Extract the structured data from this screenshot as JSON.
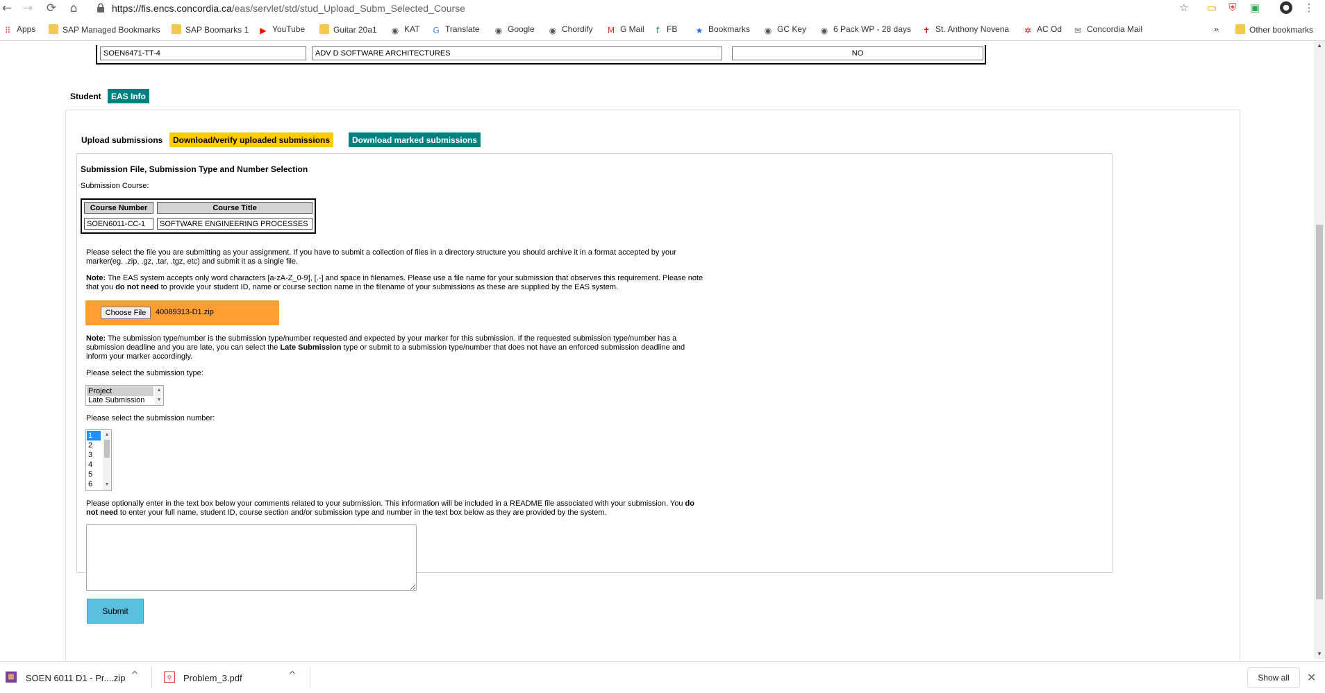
{
  "browser": {
    "url_host": "https://fis.encs.concordia.ca",
    "url_path": "/eas/servlet/std/stud_Upload_Subm_Selected_Course",
    "nav": {
      "back": "←",
      "forward": "→",
      "reload": "⟳",
      "home": "⌂"
    },
    "icons": {
      "star": "☆",
      "menu": "⋮"
    }
  },
  "bookmarks": [
    {
      "label": "Apps",
      "icon": "apps-grid-icon",
      "glyph": "⠿",
      "color": "#e8453c"
    },
    {
      "label": "SAP Managed Bookmarks",
      "icon": "folder-icon",
      "glyph": ""
    },
    {
      "label": "SAP Boomarks 1",
      "icon": "folder-icon",
      "glyph": ""
    },
    {
      "label": "YouTube",
      "icon": "youtube-icon",
      "glyph": "▶",
      "color": "#ff0000"
    },
    {
      "label": "Guitar 20a1",
      "icon": "folder-icon",
      "glyph": ""
    },
    {
      "label": "KAT",
      "icon": "globe-icon",
      "glyph": "◉",
      "color": "#555"
    },
    {
      "label": "Translate",
      "icon": "translate-icon",
      "glyph": "G",
      "color": "#4285f4"
    },
    {
      "label": "Google",
      "icon": "globe-icon",
      "glyph": "◉",
      "color": "#555"
    },
    {
      "label": "Chordify",
      "icon": "globe-icon",
      "glyph": "◉",
      "color": "#555"
    },
    {
      "label": "G Mail",
      "icon": "gmail-icon",
      "glyph": "M",
      "color": "#d93025"
    },
    {
      "label": "FB",
      "icon": "facebook-icon",
      "glyph": "f",
      "color": "#1877f2"
    },
    {
      "label": "Bookmarks",
      "icon": "star-icon",
      "glyph": "★",
      "color": "#1a73e8"
    },
    {
      "label": "GC Key",
      "icon": "globe-icon",
      "glyph": "◉",
      "color": "#555"
    },
    {
      "label": "6 Pack WP - 28 days",
      "icon": "globe-icon",
      "glyph": "◉",
      "color": "#555"
    },
    {
      "label": "St. Anthony Novena",
      "icon": "saint-icon",
      "glyph": "✝",
      "color": "#a00"
    },
    {
      "label": "AC Od",
      "icon": "air-canada-icon",
      "glyph": "✲",
      "color": "#d22"
    },
    {
      "label": "Concordia Mail",
      "icon": "mail-icon",
      "glyph": "✉",
      "color": "#666"
    }
  ],
  "bookmarks_more": "»",
  "other_bookmarks": "Other bookmarks",
  "top_row": {
    "course": "SOEN6471-TT-4",
    "title": "ADV D SOFTWARE ARCHITECTURES",
    "flag": "NO"
  },
  "tabs_main": [
    {
      "label": "Student"
    },
    {
      "label": "EAS Info"
    }
  ],
  "tabs_sub": [
    {
      "label": "Upload submissions"
    },
    {
      "label": "Download/verify uploaded submissions"
    },
    {
      "label": "Download marked submissions"
    }
  ],
  "form": {
    "section_title": "Submission File, Submission Type and Number Selection",
    "course_label": "Submission Course:",
    "table_headers": [
      "Course Number",
      "Course Title"
    ],
    "table_row": [
      "SOEN6011-CC-1",
      "SOFTWARE ENGINEERING PROCESSES"
    ],
    "para1_line1": "Please select the file you are submitting as your assignment. If you have to submit a collection of files in a directory structure you should archive it in a format accepted by your",
    "para1_line2": "marker(eg. .zip, .gz, .tar, .tgz, etc) and submit it as a single file.",
    "note1_bold": "Note:",
    "note1_a": " The EAS system accepts only word characters [a-zA-Z_0-9], [.-] and space in filenames. Please use a file name for your submission that observes this requirement. Please note",
    "note1_b1": "that you ",
    "note1_b_bold": "do not need",
    "note1_b2": " to provide your student ID, name or course section name in the filename of your submissions as these are supplied by the EAS system.",
    "choose_file": "Choose File",
    "file_name": "40089313-D1.zip",
    "note2_bold": "Note:",
    "note2_a": " The submission type/number is the submission type/number requested and expected by your marker for this submission. If the requested submission type/number has a",
    "note2_b1": "submission deadline and you are late, you can select the ",
    "note2_b_bold": "Late Submission",
    "note2_b2": " type or submit to a submission type/number that does not have an enforced submission deadline and",
    "note2_c": "inform your marker accordingly.",
    "type_label": "Please select the submission type:",
    "types": [
      "Project",
      "Late Submission"
    ],
    "number_label": "Please select the submission number:",
    "numbers": [
      "1",
      "2",
      "3",
      "4",
      "5",
      "6"
    ],
    "comments_a1": "Please optionally enter in the text box below your comments related to your submission. This information will be included in a README file associated with your submission. You ",
    "comments_a_bold": "do",
    "comments_b_bold": "not need",
    "comments_b2": " to enter your full name, student ID, course section and/or submission type and number in the text box below as they are provided by the system.",
    "submit": "Submit"
  },
  "downloads": [
    {
      "name": "SOEN 6011 D1 - Pr....zip",
      "icon": "winrar-icon"
    },
    {
      "name": "Problem_3.pdf",
      "icon": "pdf-icon"
    }
  ],
  "show_all": "Show all",
  "close": "✕",
  "colors": {
    "teal": "#008080",
    "gold": "#ffcc00",
    "orange": "#ff9f33",
    "submit": "#5bc0de"
  }
}
